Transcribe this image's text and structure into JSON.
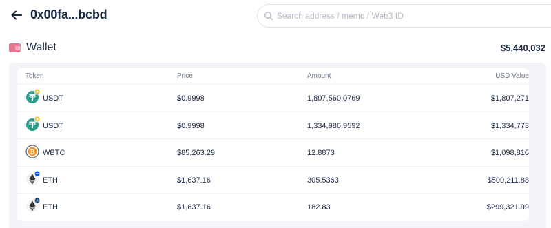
{
  "header": {
    "address": "0x00fa...bcbd",
    "search_placeholder": "Search address / memo / Web3 ID"
  },
  "wallet": {
    "label": "Wallet",
    "total": "$5,440,032"
  },
  "table": {
    "columns": [
      "Token",
      "Price",
      "Amount",
      "USD Value"
    ],
    "rows": [
      {
        "icon": "usdt-icon",
        "badge": "bnb-chain-badge-icon",
        "token": "USDT",
        "price": "$0.9998",
        "amount": "1,807,560.0769",
        "usd": "$1,807,271"
      },
      {
        "icon": "usdt-icon",
        "badge": "bnb-chain-badge-icon",
        "token": "USDT",
        "price": "$0.9998",
        "amount": "1,334,986.9592",
        "usd": "$1,334,773"
      },
      {
        "icon": "wbtc-icon",
        "badge": "",
        "token": "WBTC",
        "price": "$85,263.29",
        "amount": "12.8873",
        "usd": "$1,098,816"
      },
      {
        "icon": "eth-icon",
        "badge": "base-chain-badge-icon",
        "token": "ETH",
        "price": "$1,637.16",
        "amount": "305.5363",
        "usd": "$500,211.88"
      },
      {
        "icon": "eth-icon",
        "badge": "arbitrum-chain-badge-icon",
        "token": "ETH",
        "price": "$1,637.16",
        "amount": "182.83",
        "usd": "$299,321.99"
      }
    ]
  },
  "colors": {
    "text": "#192945",
    "muted": "#6a7587",
    "panel": "#f2f4f7",
    "wallet_icon": "#e9768c",
    "usdt": "#2a9d8f",
    "bnb": "#f0b90b",
    "base": "#0052ff",
    "arbitrum": "#28a0f0"
  }
}
